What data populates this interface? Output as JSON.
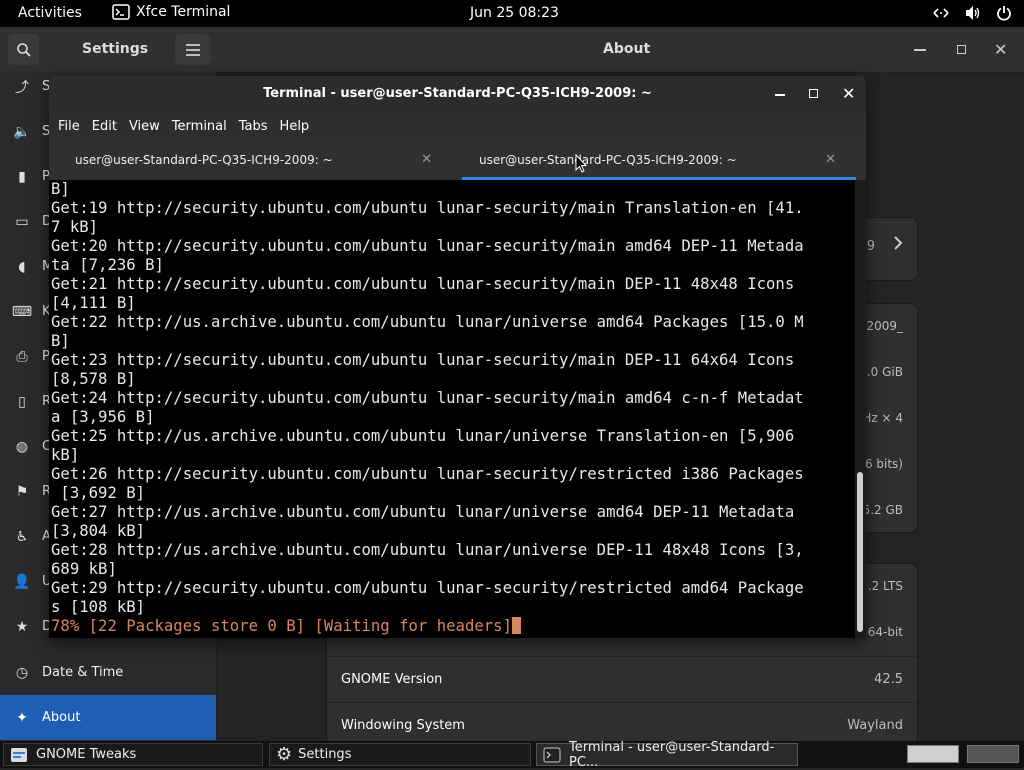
{
  "topbar": {
    "activities": "Activities",
    "app_name": "Xfce Terminal",
    "clock": "Jun 25  08:23"
  },
  "settings": {
    "title": "Settings",
    "page_title": "About",
    "sidebar_partial": [
      "S",
      "S",
      "P",
      "D",
      "M",
      "K",
      "P",
      "R",
      "C",
      "R",
      "A",
      "U",
      "D"
    ],
    "sidebar_date": "Date & Time",
    "sidebar_about": "About",
    "bg_peek": [
      "9",
      "2009_",
      ".0 GiB",
      "Hz × 4",
      "6 bits)",
      "5.2 GB",
      ".2 LTS",
      "64-bit"
    ],
    "rows": [
      {
        "label": "GNOME Version",
        "value": "42.5"
      },
      {
        "label": "Windowing System",
        "value": "Wayland"
      }
    ]
  },
  "terminal": {
    "title": "Terminal - user@user-Standard-PC-Q35-ICH9-2009: ~",
    "menu": [
      "File",
      "Edit",
      "View",
      "Terminal",
      "Tabs",
      "Help"
    ],
    "tabs": [
      {
        "label": "user@user-Standard-PC-Q35-ICH9-2009: ~"
      },
      {
        "label": "user@user-Standard-PC-Q35-ICH9-2009: ~"
      }
    ],
    "lines": [
      "B]",
      "Get:19 http://security.ubuntu.com/ubuntu lunar-security/main Translation-en [41.",
      "7 kB]",
      "Get:20 http://security.ubuntu.com/ubuntu lunar-security/main amd64 DEP-11 Metada",
      "ta [7,236 B]",
      "Get:21 http://security.ubuntu.com/ubuntu lunar-security/main DEP-11 48x48 Icons",
      "[4,111 B]",
      "Get:22 http://us.archive.ubuntu.com/ubuntu lunar/universe amd64 Packages [15.0 M",
      "B]",
      "Get:23 http://security.ubuntu.com/ubuntu lunar-security/main DEP-11 64x64 Icons",
      "[8,578 B]",
      "Get:24 http://security.ubuntu.com/ubuntu lunar-security/main amd64 c-n-f Metadat",
      "a [3,956 B]",
      "Get:25 http://us.archive.ubuntu.com/ubuntu lunar/universe Translation-en [5,906",
      "kB]",
      "Get:26 http://security.ubuntu.com/ubuntu lunar-security/restricted i386 Packages",
      " [3,692 B]",
      "Get:27 http://us.archive.ubuntu.com/ubuntu lunar/universe amd64 DEP-11 Metadata",
      "[3,804 kB]",
      "Get:28 http://us.archive.ubuntu.com/ubuntu lunar/universe DEP-11 48x48 Icons [3,",
      "689 kB]",
      "Get:29 http://security.ubuntu.com/ubuntu lunar-security/restricted amd64 Package",
      "s [108 kB]"
    ],
    "progress_line": "78% [22 Packages store 0 B] [Waiting for headers]",
    "progress_color": "#d7875f"
  },
  "taskbar": {
    "items": [
      {
        "label": "GNOME Tweaks"
      },
      {
        "label": "Settings"
      },
      {
        "label": "Terminal - user@user-Standard-PC..."
      }
    ]
  },
  "colors": {
    "accent": "#3584e4",
    "sidebar_active": "#1f5fb3"
  }
}
